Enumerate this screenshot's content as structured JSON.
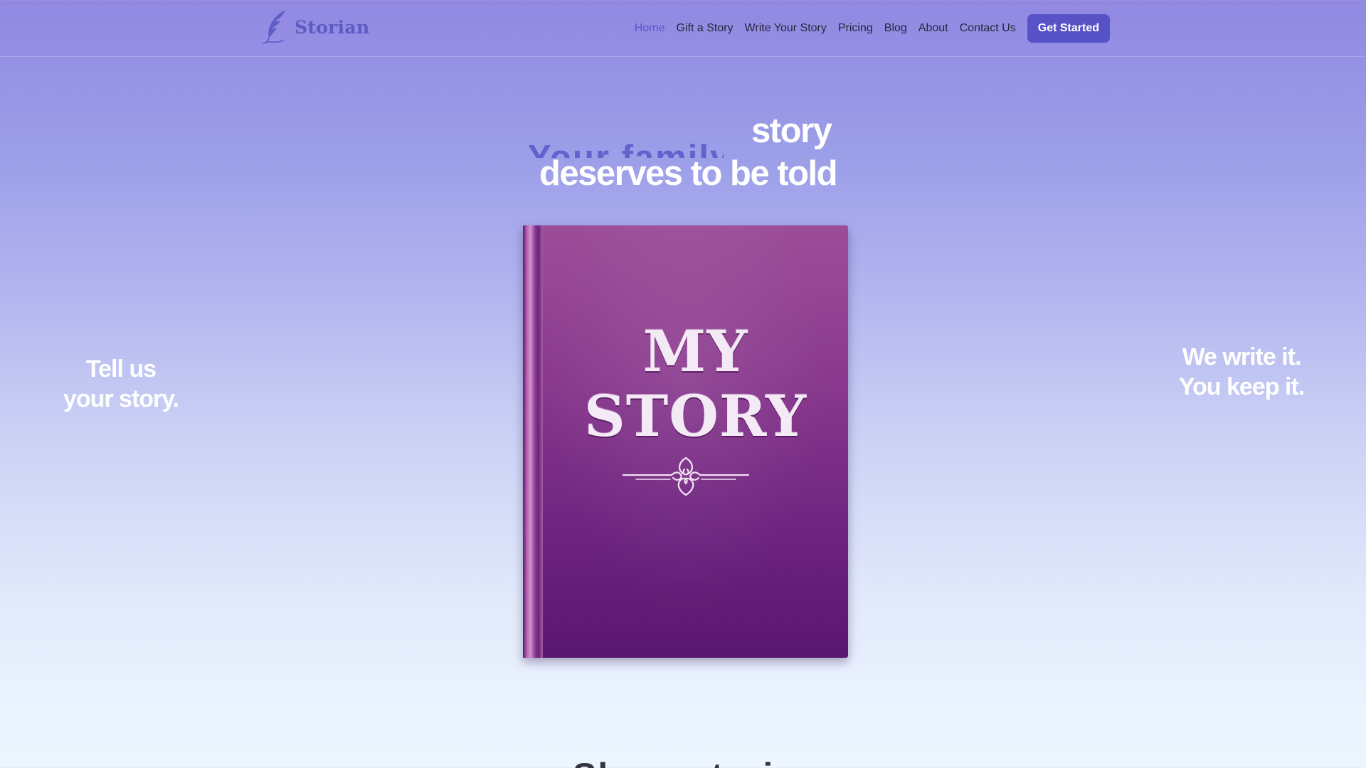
{
  "brand": {
    "name": "Storian",
    "logo_icon": "quill-icon",
    "accent_color": "#5852c7"
  },
  "nav": {
    "items": [
      {
        "label": "Home",
        "active": true
      },
      {
        "label": "Gift a Story",
        "active": false
      },
      {
        "label": "Write Your Story",
        "active": false
      },
      {
        "label": "Pricing",
        "active": false
      },
      {
        "label": "Blog",
        "active": false
      },
      {
        "label": "About",
        "active": false
      },
      {
        "label": "Contact Us",
        "active": false
      }
    ],
    "cta_label": "Get Started"
  },
  "hero": {
    "rotating_word": "Your family's",
    "heading_word": "story",
    "heading_line_two": "deserves to be told",
    "book": {
      "title_line_1": "MY",
      "title_line_2": "STORY",
      "ornament_icon": "flourish-ornament-icon",
      "cover_color": "#7a2d86"
    },
    "tagline_left": [
      "Tell us",
      "your story."
    ],
    "tagline_right": [
      "We write it.",
      "You keep it."
    ]
  },
  "next_section": {
    "heading": "Share stories"
  }
}
